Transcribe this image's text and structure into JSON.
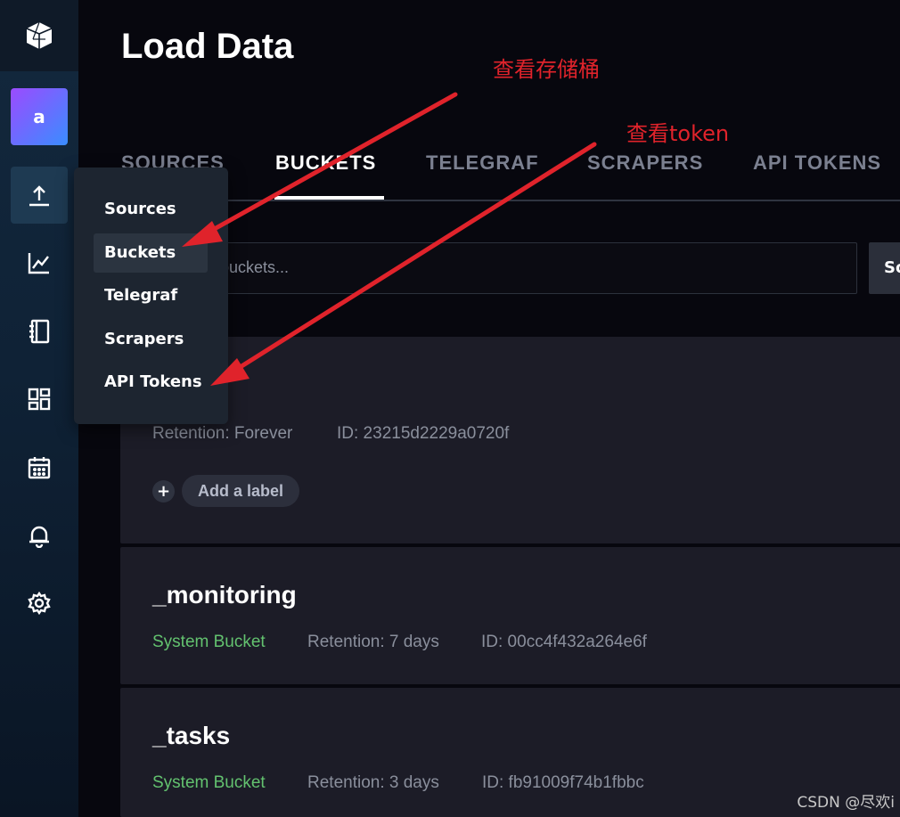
{
  "sidebar": {
    "avatar_letter": "a",
    "logo_icon": "influx-cube-icon",
    "items": [
      {
        "icon": "upload-icon",
        "active": true
      },
      {
        "icon": "chart-icon",
        "active": false
      },
      {
        "icon": "notebook-icon",
        "active": false
      },
      {
        "icon": "dashboard-icon",
        "active": false
      },
      {
        "icon": "calendar-icon",
        "active": false
      },
      {
        "icon": "bell-icon",
        "active": false
      },
      {
        "icon": "gear-icon",
        "active": false
      }
    ]
  },
  "popup_menu": {
    "items": [
      {
        "label": "Sources"
      },
      {
        "label": "Buckets",
        "active": true
      },
      {
        "label": "Telegraf"
      },
      {
        "label": "Scrapers"
      },
      {
        "label": "API Tokens"
      }
    ]
  },
  "page": {
    "title": "Load Data",
    "tabs": [
      {
        "label": "SOURCES"
      },
      {
        "label": "BUCKETS",
        "active": true
      },
      {
        "label": "TELEGRAF"
      },
      {
        "label": "SCRAPERS"
      },
      {
        "label": "API TOKENS"
      }
    ],
    "search_placeholder": "buckets...",
    "sort_button": "So"
  },
  "buckets": [
    {
      "retention": "Retention: Forever",
      "id": "ID: 23215d2229a0720f",
      "add_label": "Add a label"
    },
    {
      "name": "_monitoring",
      "type": "System Bucket",
      "retention": "Retention: 7 days",
      "id": "ID: 00cc4f432a264e6f"
    },
    {
      "name": "_tasks",
      "type": "System Bucket",
      "retention": "Retention: 3 days",
      "id": "ID: fb91009f74b1fbbc"
    }
  ],
  "annotations": {
    "buckets_note": "查看存储桶",
    "token_note": "查看token",
    "color": "#e0232b"
  },
  "watermark": "CSDN @尽欢i"
}
